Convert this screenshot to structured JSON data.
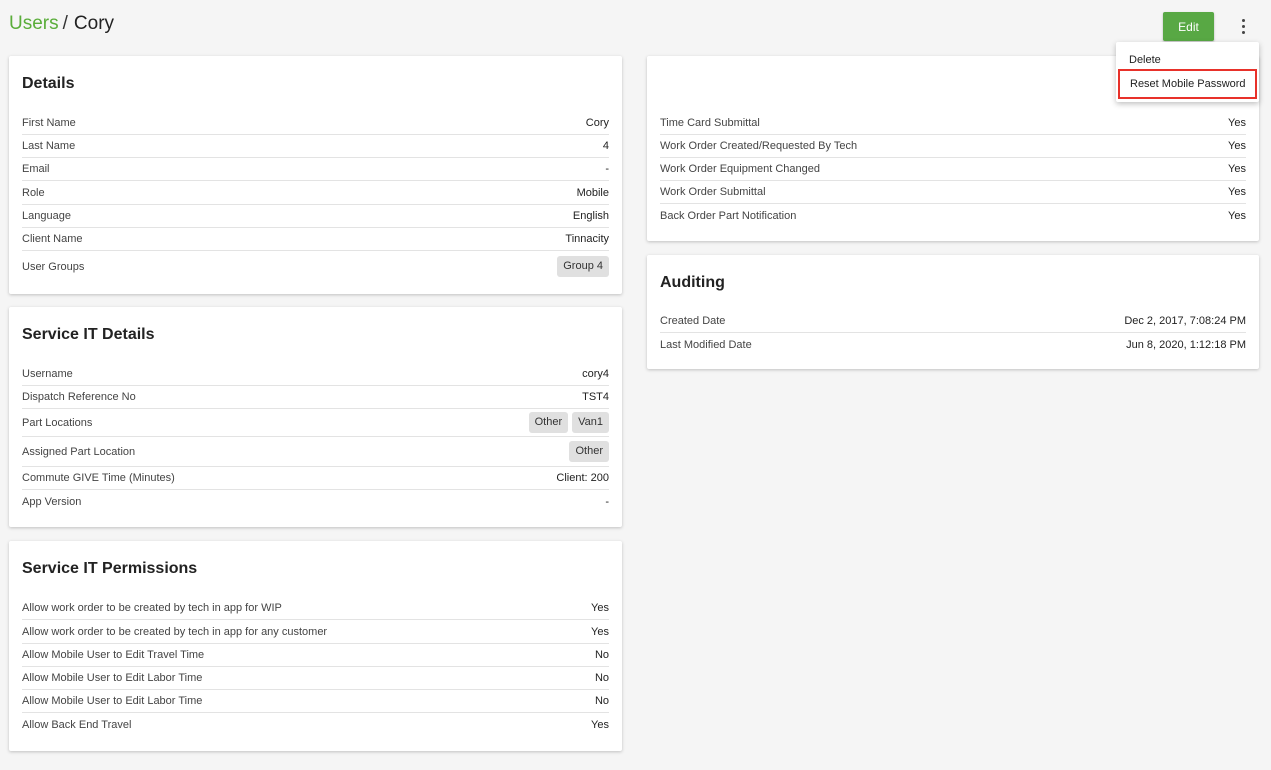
{
  "header": {
    "breadcrumb_parent": "Users",
    "breadcrumb_separator": "/",
    "breadcrumb_current": "Cory",
    "edit_label": "Edit"
  },
  "menu": {
    "delete_label": "Delete",
    "reset_label": "Reset Mobile Password"
  },
  "details": {
    "title": "Details",
    "rows": [
      {
        "label": "First Name",
        "value": "Cory"
      },
      {
        "label": "Last Name",
        "value": "4"
      },
      {
        "label": "Email",
        "value": "-"
      },
      {
        "label": "Role",
        "value": "Mobile"
      },
      {
        "label": "Language",
        "value": "English"
      },
      {
        "label": "Client Name",
        "value": "Tinnacity"
      },
      {
        "label": "User Groups",
        "chips": [
          "Group 4"
        ]
      }
    ]
  },
  "service_it_details": {
    "title": "Service IT Details",
    "rows": [
      {
        "label": "Username",
        "value": "cory4"
      },
      {
        "label": "Dispatch Reference No",
        "value": "TST4"
      },
      {
        "label": "Part Locations",
        "chips": [
          "Other",
          "Van1"
        ]
      },
      {
        "label": "Assigned Part Location",
        "chips": [
          "Other"
        ]
      },
      {
        "label": "Commute GIVE Time (Minutes)",
        "value": "Client: 200"
      },
      {
        "label": "App Version",
        "value": "-"
      }
    ]
  },
  "service_it_permissions": {
    "title": "Service IT Permissions",
    "rows": [
      {
        "label": "Allow work order to be created by tech in app for WIP",
        "value": "Yes"
      },
      {
        "label": "Allow work order to be created by tech in app for any customer",
        "value": "Yes"
      },
      {
        "label": "Allow Mobile User to Edit Travel Time",
        "value": "No"
      },
      {
        "label": "Allow Mobile User to Edit Labor Time",
        "value": "No"
      },
      {
        "label": "Allow Mobile User to Edit Labor Time",
        "value": "No"
      },
      {
        "label": "Allow Back End Travel",
        "value": "Yes"
      }
    ]
  },
  "notifications": {
    "rows": [
      {
        "label": "Time Card Submittal",
        "value": "Yes"
      },
      {
        "label": "Work Order Created/Requested By Tech",
        "value": "Yes"
      },
      {
        "label": "Work Order Equipment Changed",
        "value": "Yes"
      },
      {
        "label": "Work Order Submittal",
        "value": "Yes"
      },
      {
        "label": "Back Order Part Notification",
        "value": "Yes"
      }
    ]
  },
  "auditing": {
    "title": "Auditing",
    "rows": [
      {
        "label": "Created Date",
        "value": "Dec 2, 2017, 7:08:24 PM"
      },
      {
        "label": "Last Modified Date",
        "value": "Jun 8, 2020, 1:12:18 PM"
      }
    ]
  }
}
